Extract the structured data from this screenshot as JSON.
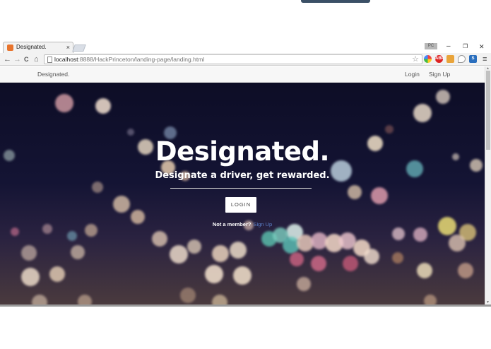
{
  "browser": {
    "tab": {
      "title": "Designated.",
      "close_glyph": "×",
      "favicon": "designated-favicon"
    },
    "profile_label": "PC",
    "window_controls": {
      "minimize": "–",
      "maximize": "❐",
      "close": "✕"
    },
    "address_bar": {
      "host": "localhost",
      "path": ":8888/HackPrinceton/landing-page/landing.html"
    },
    "nav_icons": {
      "back": "←",
      "forward": "→",
      "reload": "C",
      "home": "⌂"
    },
    "extensions": [
      "color-picker-icon",
      "adblock-icon",
      "bookmark-icon",
      "location-icon",
      "s-icon"
    ],
    "extension_labels": [
      "",
      "ABP",
      "",
      "",
      "S"
    ],
    "menu_glyph": "≡"
  },
  "page": {
    "navbar": {
      "brand": "Designated.",
      "links": [
        "Login",
        "Sign Up"
      ]
    },
    "hero": {
      "title": "Designated.",
      "subtitle": "Designate a driver, get rewarded.",
      "login_button": "LOGIN",
      "member_text": "Not a member?",
      "signup_link": "Sign Up"
    }
  },
  "colors": {
    "hero_background": "#0d0d26",
    "link": "#5b7fc7",
    "accent_tab": "#e8742d"
  }
}
